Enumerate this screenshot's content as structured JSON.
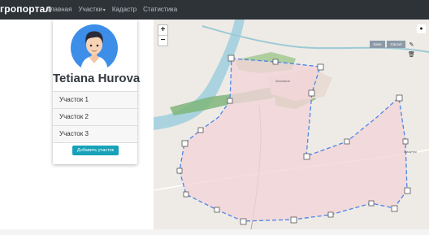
{
  "navbar": {
    "brand": "гропортал",
    "items": [
      {
        "label": "Главная"
      },
      {
        "label": "Участки",
        "caret": "▾"
      },
      {
        "label": "Кадастр"
      },
      {
        "label": "Статистика"
      }
    ]
  },
  "profile": {
    "name": "Tetiana Hurova",
    "plots": [
      "Участок 1",
      "Участок 2",
      "Участок 3"
    ],
    "add_button": "Добавить участок"
  },
  "map": {
    "zoom_in": "+",
    "zoom_out": "−",
    "mini_buttons": [
      "Save",
      "Cancel"
    ],
    "labels": [
      "Заплавне",
      "Кушугум"
    ]
  },
  "colors": {
    "navbar": "#2e3338",
    "accent": "#17a2b8",
    "avatar": "#3c8ee8",
    "polygon_fill": "#f3d5d8",
    "polygon_stroke": "#4a86e8"
  }
}
